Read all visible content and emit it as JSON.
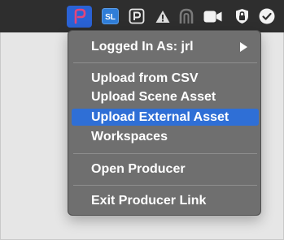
{
  "menubar": {
    "icons": [
      {
        "name": "producer-app-icon",
        "glyph": "P",
        "active": true
      },
      {
        "name": "sl-app-icon",
        "glyph": "SL"
      },
      {
        "name": "p-box-icon",
        "glyph": "P"
      },
      {
        "name": "warning-triangle-icon",
        "glyph": "!"
      },
      {
        "name": "arch-icon"
      },
      {
        "name": "camera-icon"
      },
      {
        "name": "lock-icon"
      },
      {
        "name": "checkmark-icon"
      }
    ],
    "accent_color": "#2a62d5"
  },
  "menu": {
    "logged_in_label": "Logged In As: jrl",
    "items": [
      {
        "label": "Upload from CSV"
      },
      {
        "label": "Upload Scene Asset"
      },
      {
        "label": "Upload External Asset",
        "highlighted": true
      },
      {
        "label": "Workspaces"
      }
    ],
    "open_producer": "Open Producer",
    "exit_producer_link": "Exit Producer Link",
    "highlight_color": "#2f6fd6"
  }
}
